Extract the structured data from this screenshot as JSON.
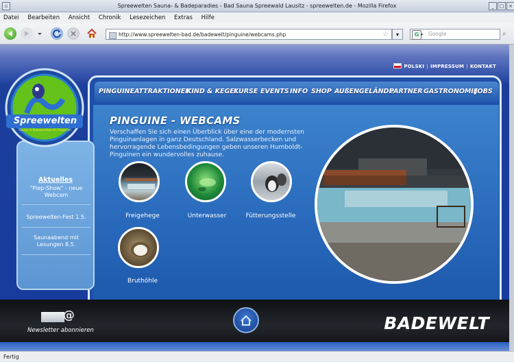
{
  "window": {
    "title": "Spreewelten Sauna- & Badeparadies - Bad Sauna Spreewald Lausitz - spreewelten.de - Mozilla Firefox"
  },
  "menu": [
    "Datei",
    "Bearbeiten",
    "Ansicht",
    "Chronik",
    "Lesezeichen",
    "Extras",
    "Hilfe"
  ],
  "url": "http://www.spreewelten-bad.de/badewelt/pinguine/webcams.php",
  "search": {
    "placeholder": "Google"
  },
  "status": "Fertig",
  "toplinks": {
    "polski": "POLSKI",
    "impressum": "IMPRESSUM",
    "kontakt": "KONTAKT"
  },
  "logo": {
    "text": "Spreewelten",
    "tagline": "Sauna- & Badeparadies mit Pinguinen"
  },
  "nav": [
    "PINGUINE",
    "ATTRAKTIONEN",
    "KIND & KEGEL",
    "KURSE",
    "EVENTS",
    "INFO",
    "SHOP",
    "AUßENGELÄNDE",
    "PARTNER",
    "GASTRONOMIE",
    "JOBS"
  ],
  "page": {
    "title": "PINGUINE - WEBCAMS",
    "intro": "Verschaffen Sie sich einen Überblick über eine der modernsten Pinguinanlagen in ganz Deutschland. Salzwasserbecken und hervorragende Lebensbedingungen geben unseren Humboldt-Pinguinen ein wundervolles zuhause."
  },
  "webcams": [
    {
      "label": "Freigehege"
    },
    {
      "label": "Unterwasser"
    },
    {
      "label": "Fütterungsstelle"
    },
    {
      "label": "Bruthöhle"
    }
  ],
  "sidebar": {
    "heading": "Aktuelles",
    "items": [
      "\"Piep-Show\" - neue Webcam",
      "Spreewelten-Fest 1.5.",
      "Saunaabend mit Lesungen 8.5."
    ]
  },
  "footer": {
    "newsletter": "Newsletter abonnieren",
    "brand": "BADEWELT"
  },
  "colors": {
    "nav_blue": "#1f56ac",
    "page_blue": "#163b9e",
    "logo_green": "#64c21a"
  }
}
